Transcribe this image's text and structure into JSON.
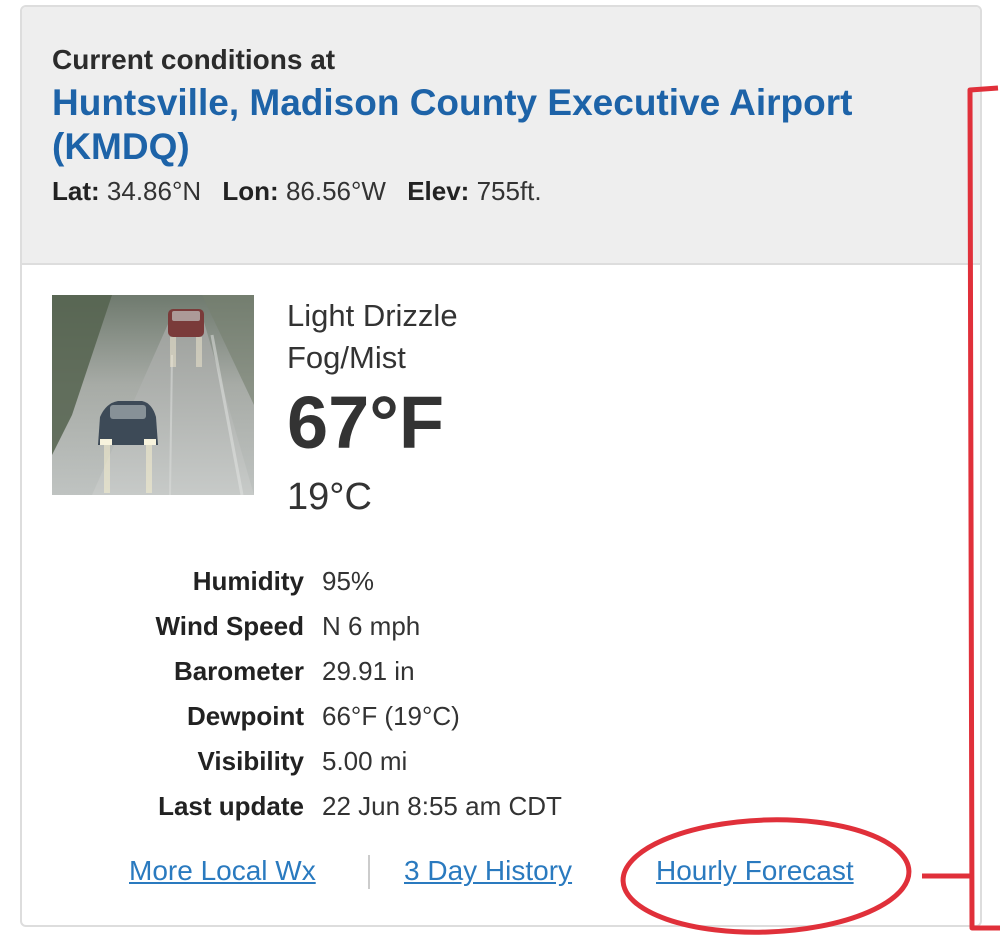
{
  "header": {
    "subtitle": "Current conditions at",
    "station_name": "Huntsville, Madison County Executive Airport (KMDQ)",
    "lat_label": "Lat:",
    "lat_value": "34.86°N",
    "lon_label": "Lon:",
    "lon_value": "86.56°W",
    "elev_label": "Elev:",
    "elev_value": "755ft."
  },
  "current": {
    "condition_1": "Light Drizzle",
    "condition_2": "Fog/Mist",
    "temp_f": "67°F",
    "temp_c": "19°C",
    "image_icon": "weather-photo-rainy-road"
  },
  "details": [
    {
      "label": "Humidity",
      "value": "95%"
    },
    {
      "label": "Wind Speed",
      "value": "N 6 mph"
    },
    {
      "label": "Barometer",
      "value": "29.91 in"
    },
    {
      "label": "Dewpoint",
      "value": "66°F (19°C)"
    },
    {
      "label": "Visibility",
      "value": "5.00 mi"
    },
    {
      "label": "Last update",
      "value": "22 Jun 8:55 am CDT"
    }
  ],
  "links": {
    "more_local": "More Local Wx",
    "history": "3 Day History",
    "hourly": "Hourly Forecast"
  },
  "colors": {
    "accent": "#1d63a8",
    "link": "#2a7abf",
    "annotation": "#e0303a",
    "header_bg": "#eeeeee"
  }
}
